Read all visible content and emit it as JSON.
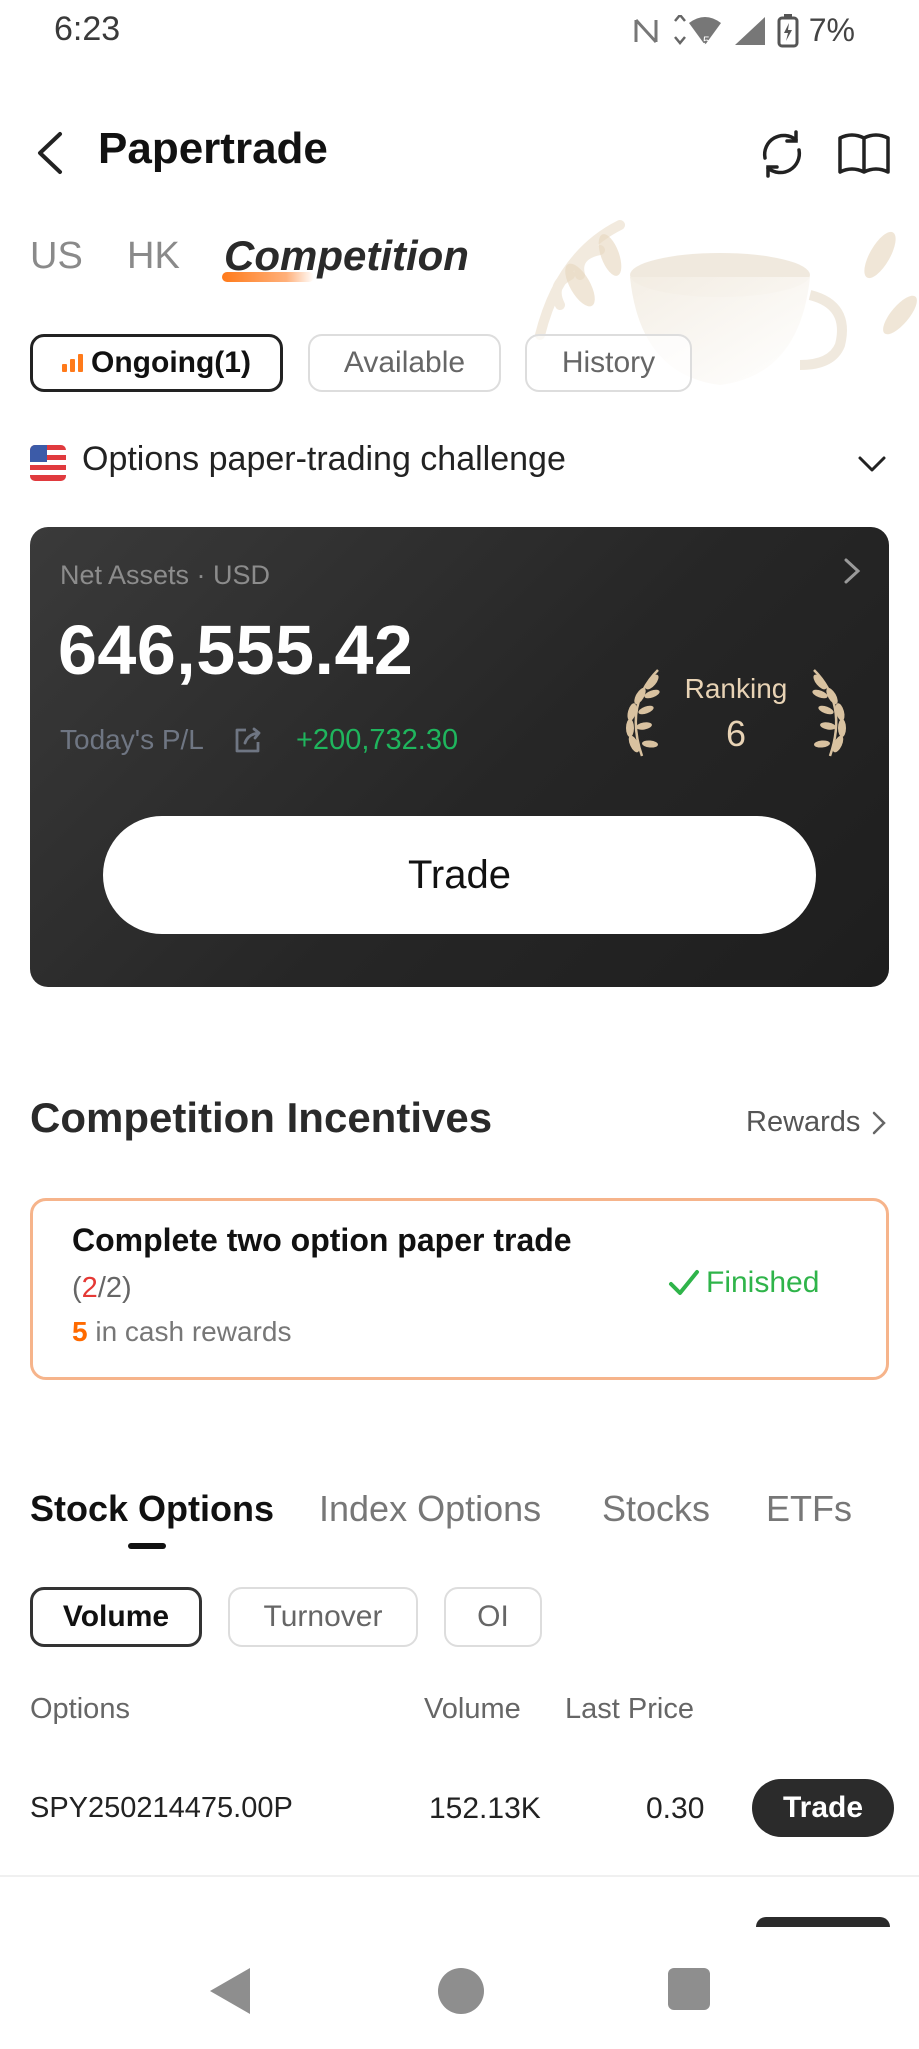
{
  "status_bar": {
    "time": "6:23",
    "battery": "7%",
    "network_badge": "5"
  },
  "header": {
    "title": "Papertrade",
    "back_icon": "chevron-left-icon",
    "refresh_icon": "refresh-icon",
    "guide_icon": "book-icon"
  },
  "market_tabs": [
    "US",
    "HK",
    "Competition"
  ],
  "status_pills": [
    "Ongoing(1)",
    "Available",
    "History"
  ],
  "challenge": {
    "name": "Options paper-trading challenge",
    "flag": "us-flag-icon"
  },
  "account_card": {
    "net_assets_label": "Net Assets · USD",
    "net_assets_value": "646,555.42",
    "today_pl_label": "Today's P/L",
    "today_pl_value": "+200,732.30",
    "ranking_label": "Ranking",
    "ranking_value": "6",
    "trade_button": "Trade"
  },
  "incentives": {
    "title": "Competition Incentives",
    "rewards_link": "Rewards",
    "task": {
      "title": "Complete two option paper trade",
      "progress_open": "(",
      "progress_done": "2",
      "progress_total": "/2)",
      "reward_amount": "5",
      "reward_text": " in cash rewards",
      "status": "Finished"
    }
  },
  "option_tabs": [
    "Stock Options",
    "Index Options",
    "Stocks",
    "ETFs"
  ],
  "filters": [
    "Volume",
    "Turnover",
    "OI"
  ],
  "table": {
    "columns": [
      "Options",
      "Volume",
      "Last Price"
    ],
    "rows": [
      {
        "symbol": "SPY250214475.00P",
        "volume": "152.13K",
        "last_price": "0.30",
        "action": "Trade"
      }
    ]
  },
  "colors": {
    "accent": "#ff7a1a",
    "positive": "#1fb55d",
    "card_bg": "#2a2a2a",
    "finished": "#2fb44a",
    "task_border": "#f6b48b"
  }
}
